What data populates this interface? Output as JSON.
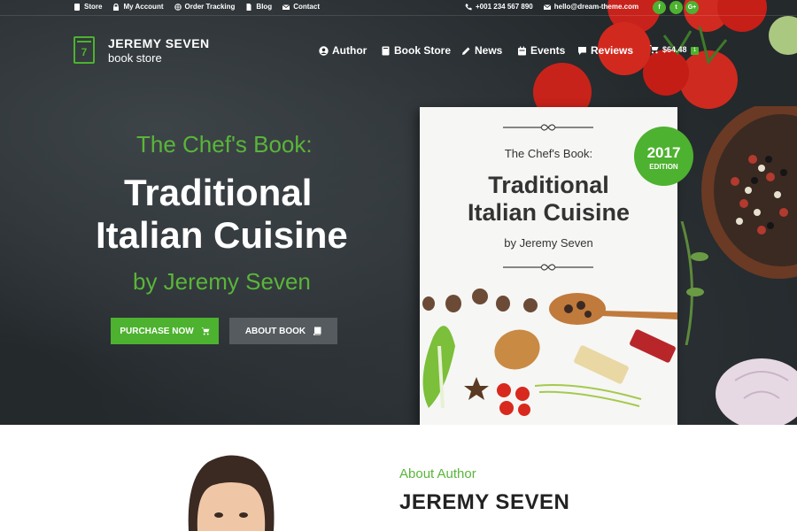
{
  "topbar": {
    "links": [
      {
        "label": "Store",
        "icon": "store-icon"
      },
      {
        "label": "My Account",
        "icon": "lock-icon"
      },
      {
        "label": "Order Tracking",
        "icon": "globe-icon"
      },
      {
        "label": "Blog",
        "icon": "document-icon"
      },
      {
        "label": "Contact",
        "icon": "envelope-icon"
      }
    ],
    "phone": "+001 234 567 890",
    "email": "hello@dream-theme.com",
    "social": [
      "f",
      "t",
      "G+"
    ]
  },
  "logo": {
    "number": "7",
    "title": "JEREMY SEVEN",
    "subtitle": "book store"
  },
  "nav": {
    "items": [
      {
        "label": "Author",
        "icon": "user-icon"
      },
      {
        "label": "Book Store",
        "icon": "book-icon"
      },
      {
        "label": "News",
        "icon": "pencil-icon"
      },
      {
        "label": "Events",
        "icon": "calendar-icon"
      },
      {
        "label": "Reviews",
        "icon": "comment-icon"
      }
    ],
    "cart_total": "$64.48",
    "cart_count": "1"
  },
  "hero": {
    "kicker": "The Chef's Book:",
    "title_line1": "Traditional",
    "title_line2": "Italian Cuisine",
    "author": "by Jeremy Seven",
    "purchase_label": "PURCHASE NOW",
    "about_label": "ABOUT BOOK"
  },
  "book": {
    "kicker": "The Chef's Book:",
    "title_line1": "Traditional",
    "title_line2": "Italian Cuisine",
    "author": "by Jeremy Seven",
    "edition_year": "2017",
    "edition_label": "EDITION"
  },
  "about": {
    "kicker": "About Author",
    "name": "JEREMY SEVEN"
  },
  "colors": {
    "accent": "#4db22f",
    "hero_bg": "#24292c",
    "text_dark": "#222222"
  }
}
